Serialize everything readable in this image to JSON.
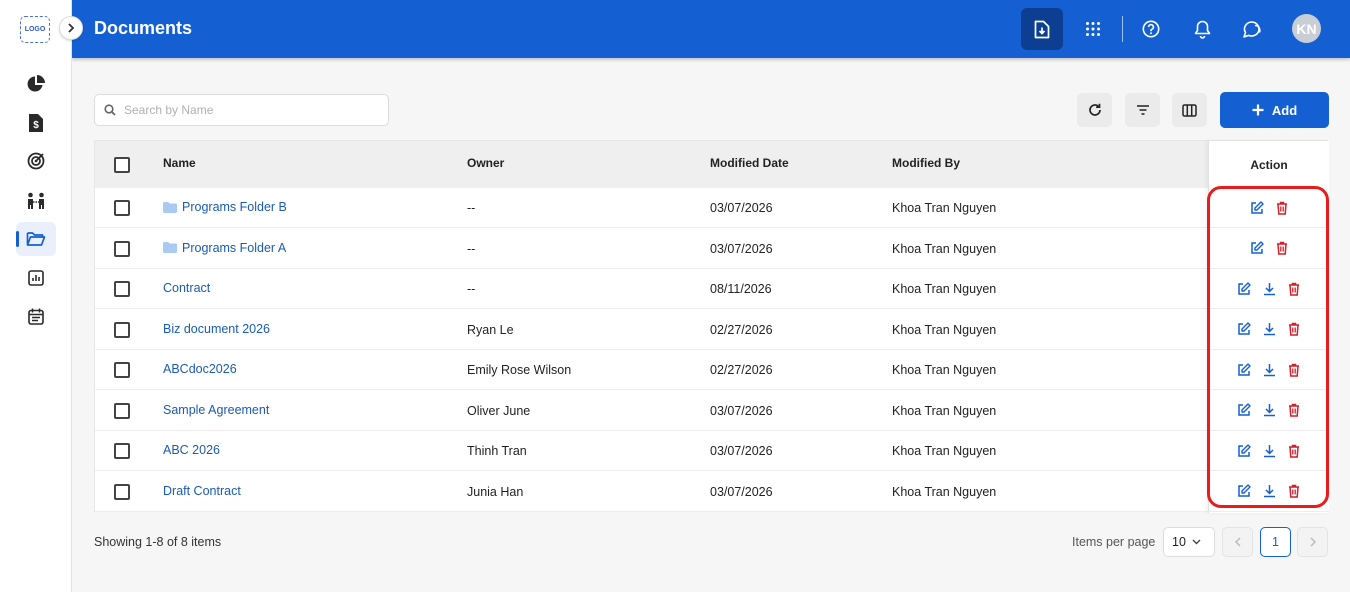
{
  "app": {
    "logo_text": "LOGO",
    "page_title": "Documents"
  },
  "topbar": {
    "avatar_initials": "KN",
    "accent": "#1460d3"
  },
  "sidebar": {
    "items": [
      {
        "icon": "pie-chart-icon"
      },
      {
        "icon": "dollar-document-icon"
      },
      {
        "icon": "target-icon"
      },
      {
        "icon": "people-icon"
      },
      {
        "icon": "folder-open-icon",
        "active": true
      },
      {
        "icon": "bar-chart-icon"
      },
      {
        "icon": "calendar-icon"
      }
    ]
  },
  "toolbar": {
    "search_placeholder": "Search by Name",
    "add_label": "Add"
  },
  "table": {
    "headers": {
      "name": "Name",
      "owner": "Owner",
      "modified_date": "Modified Date",
      "modified_by": "Modified By",
      "action": "Action"
    },
    "rows": [
      {
        "name": "Programs Folder B",
        "is_folder": true,
        "owner": "--",
        "modified_date": "03/07/2026",
        "modified_by": "Khoa Tran Nguyen"
      },
      {
        "name": "Programs Folder A",
        "is_folder": true,
        "owner": "--",
        "modified_date": "03/07/2026",
        "modified_by": "Khoa Tran Nguyen"
      },
      {
        "name": "Contract",
        "is_folder": false,
        "owner": "--",
        "modified_date": "08/11/2026",
        "modified_by": "Khoa Tran Nguyen"
      },
      {
        "name": "Biz document 2026",
        "is_folder": false,
        "owner": "Ryan Le",
        "modified_date": "02/27/2026",
        "modified_by": "Khoa Tran Nguyen"
      },
      {
        "name": "ABCdoc2026",
        "is_folder": false,
        "owner": "Emily Rose Wilson",
        "modified_date": "02/27/2026",
        "modified_by": "Khoa Tran Nguyen"
      },
      {
        "name": "Sample Agreement",
        "is_folder": false,
        "owner": "Oliver June",
        "modified_date": "03/07/2026",
        "modified_by": "Khoa Tran Nguyen"
      },
      {
        "name": "ABC 2026",
        "is_folder": false,
        "owner": "Thinh Tran",
        "modified_date": "03/07/2026",
        "modified_by": "Khoa Tran Nguyen"
      },
      {
        "name": "Draft Contract",
        "is_folder": false,
        "owner": "Junia Han",
        "modified_date": "03/07/2026",
        "modified_by": "Khoa Tran Nguyen"
      }
    ]
  },
  "footer": {
    "showing_text": "Showing 1-8 of 8 items",
    "items_per_page_label": "Items per page",
    "items_per_page_value": "10",
    "current_page": "1"
  }
}
